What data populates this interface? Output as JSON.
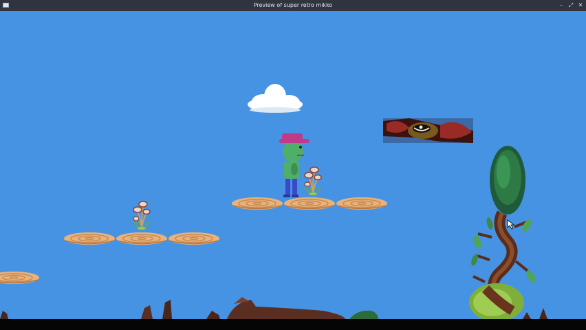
{
  "window": {
    "title": "Preview of super retro mikko",
    "controls": {
      "minimize": "–",
      "maximize": "⤢",
      "close": "✕"
    }
  },
  "scene": {
    "sky_color": "#4693e3",
    "platform_color": "#e8b27c",
    "platform_ring_color": "#c88a52",
    "icons": [
      "cloud-icon",
      "player-character-icon",
      "flying-enemy-icon",
      "mushroom-plant-icon",
      "tree-icon",
      "wooden-platform-icon",
      "cursor-icon"
    ]
  }
}
